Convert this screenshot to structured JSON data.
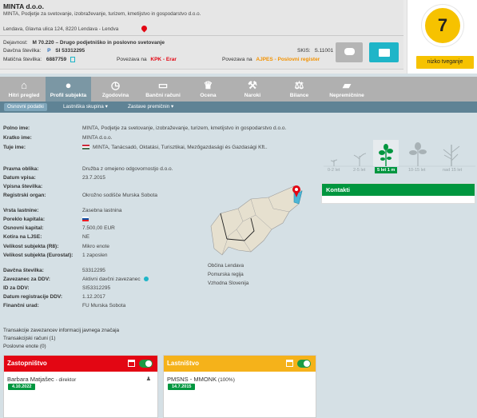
{
  "company": {
    "short_name": "MINTA d.o.o.",
    "full_name": "MINTA, Podjetje za svetovanje, izobraževanje, turizem, kmetijstvo in gospodarstvo d.o.o.",
    "address": "Lendava, Glavna ulica 124, 8220 Lendava - Lendva"
  },
  "header": {
    "dejavnost_label": "Dejavnost:",
    "dejavnost_value": "M 70.220 – Drugo podjetniško in poslovno svetovanje",
    "davcna_label": "Davčna številka:",
    "davcna_p": "P",
    "davcna_value": "SI 53312295",
    "maticna_label": "Matična številka:",
    "maticna_value": "6887759",
    "povezava_kpk_prefix": "Povezava na",
    "povezava_kpk_link": "KPK - Erar",
    "skis_label": "SKIS:",
    "skis_value": "S.11001",
    "povezava_ajpes_prefix": "Povezava na",
    "povezava_ajpes_link": "AJPES - Poslovni register"
  },
  "score": {
    "value": "7",
    "risk_label": "nizko tveganje",
    "color": "#f6c200"
  },
  "tabs": [
    {
      "label": "Hitri pregled",
      "icon": "home-icon"
    },
    {
      "label": "Profil subjekta",
      "icon": "user-icon"
    },
    {
      "label": "Zgodovina",
      "icon": "clock-icon"
    },
    {
      "label": "Bančni računi",
      "icon": "card-icon"
    },
    {
      "label": "Ocena",
      "icon": "trophy-icon"
    },
    {
      "label": "Naroki",
      "icon": "gavel-icon"
    },
    {
      "label": "Bilance",
      "icon": "scales-icon"
    },
    {
      "label": "Nepremičnine",
      "icon": "slovenia-icon"
    }
  ],
  "subtabs": [
    "Osnovni podatki",
    "Lastniška skupina ▾",
    "Zastave premičnin ▾"
  ],
  "details": {
    "polno_ime_label": "Polno ime:",
    "polno_ime": "MINTA, Podjetje za svetovanje, izobraževanje, turizem, kmetijstvo in gospodarstvo d.o.o.",
    "kratko_ime_label": "Kratko ime:",
    "kratko_ime": "MINTA d.o.o.",
    "tuje_ime_label": "Tuje ime:",
    "tuje_ime": "MINTA, Tanácsadó, Oktatási, Turisztikai, Mezőgazdasági és Gazdasági Kft..",
    "pravna_oblika_label": "Pravna oblika:",
    "pravna_oblika": "Družba z omejeno odgovornostjo d.o.o.",
    "datum_vpisa_label": "Datum vpisa:",
    "datum_vpisa": "23.7.2015",
    "vpisna_label": "Vpisna številka:",
    "vpisna": "",
    "registrski_organ_label": "Registrski organ:",
    "registrski_organ": "Okrožno sodišče Murska Sobota",
    "vrsta_lastnine_label": "Vrsta lastnine:",
    "vrsta_lastnine": "Zasebna lastnina",
    "poreklo_label": "Poreklo kapitala:",
    "osnovni_kapital_label": "Osnovni kapital:",
    "osnovni_kapital": "7.500,00 EUR",
    "kotira_label": "Kotira na LJSE:",
    "kotira": "NE",
    "velikost_r8_label": "Velikost subjekta (R8):",
    "velikost_r8": "Mikro enote",
    "velikost_eurostat_label": "Velikost subjekta (Eurostat):",
    "velikost_eurostat": "1 zaposlen",
    "davcna_label": "Davčna številka:",
    "davcna": "53312295",
    "zavezanec_label": "Zavezanec za DDV:",
    "zavezanec": "Aktivni davčni zavezanec",
    "id_ddv_label": "ID za DDV:",
    "id_ddv": "SI53312295",
    "datum_ddv_label": "Datum registracije DDV:",
    "datum_ddv": "1.12.2017",
    "financni_urad_label": "Finančni urad:",
    "financni_urad": "FU Murska Sobota"
  },
  "map": {
    "obcina": "Občina Lendava",
    "regija": "Pomurska regija",
    "kohezija": "Vzhodna Slovenija"
  },
  "age_timeline": {
    "labels": [
      "0-2 let",
      "2-5 let",
      "5 let 1 m",
      "10-15 let",
      "nad 15 let"
    ],
    "active_index": 2
  },
  "kontakti": {
    "title": "Kontakti"
  },
  "transactions": {
    "line1": "Transakcije zavezancev informacij javnega značaja",
    "line2": "Transakcijski računi (1)",
    "line3": "Poslovne enote (0)"
  },
  "zastopnistvo": {
    "title": "Zastopništvo",
    "name": "Barbara Matjašec",
    "role": " - direktor",
    "date": "4.10.2022",
    "color": "#e30613"
  },
  "lastnistvo": {
    "title": "Lastništvo",
    "name": "PMSNS - MMONK",
    "share": " (100%)",
    "date": "14.7.2015",
    "color": "#f5b21a"
  }
}
